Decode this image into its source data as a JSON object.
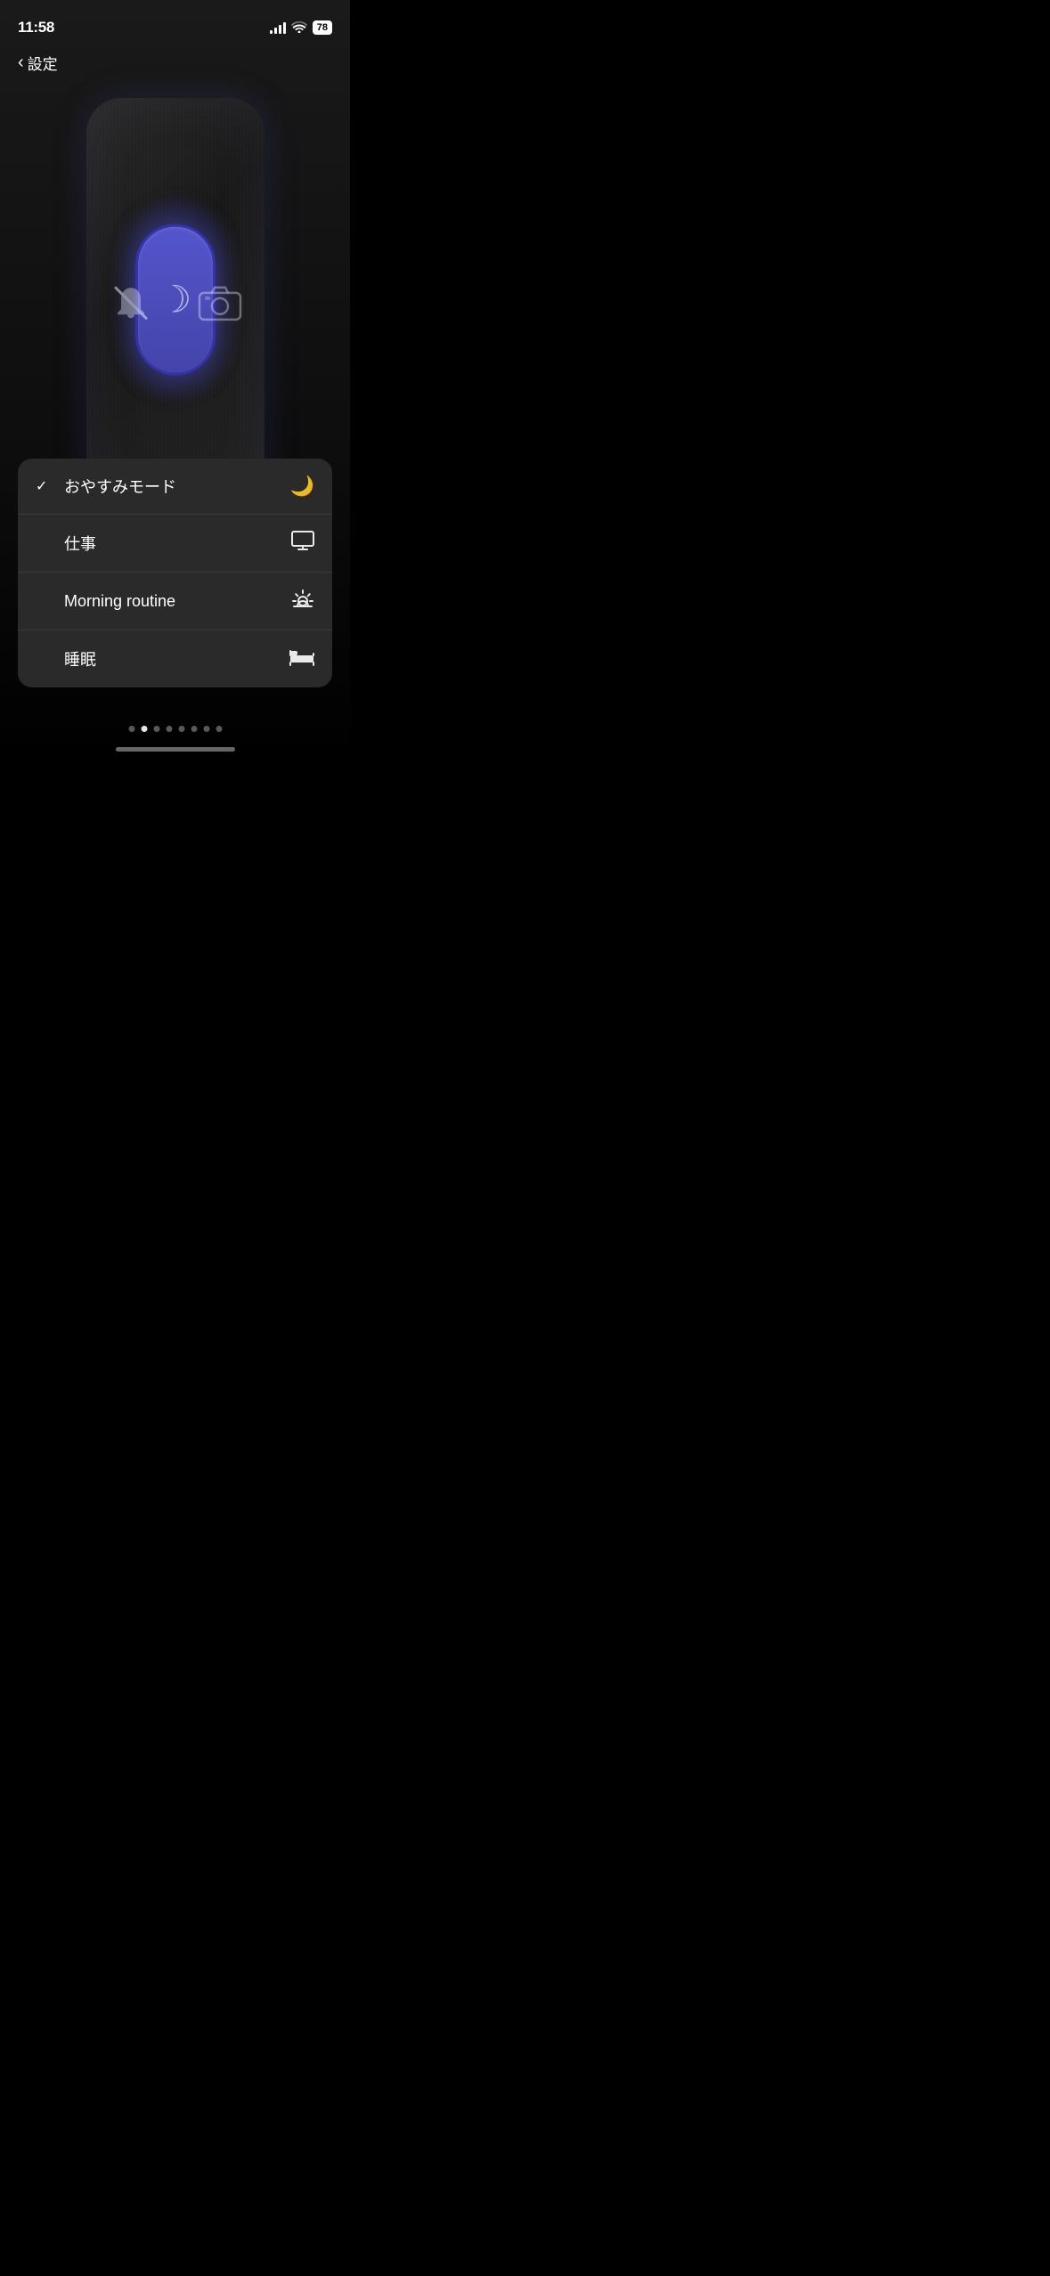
{
  "status": {
    "time": "11:58",
    "battery": "78",
    "signal_bars": [
      4,
      7,
      10,
      13
    ],
    "has_notification": true
  },
  "nav": {
    "back_label": "設定"
  },
  "page_dots": {
    "count": 8,
    "active_index": 1
  },
  "menu": {
    "items": [
      {
        "id": "dnd",
        "label": "おやすみモード",
        "checked": true,
        "icon": "moon"
      },
      {
        "id": "work",
        "label": "仕事",
        "checked": false,
        "icon": "monitor"
      },
      {
        "id": "morning",
        "label": "Morning routine",
        "checked": false,
        "icon": "sunrise"
      },
      {
        "id": "sleep",
        "label": "睡眠",
        "checked": false,
        "icon": "bed"
      }
    ]
  },
  "home_indicator": {
    "visible": true
  }
}
